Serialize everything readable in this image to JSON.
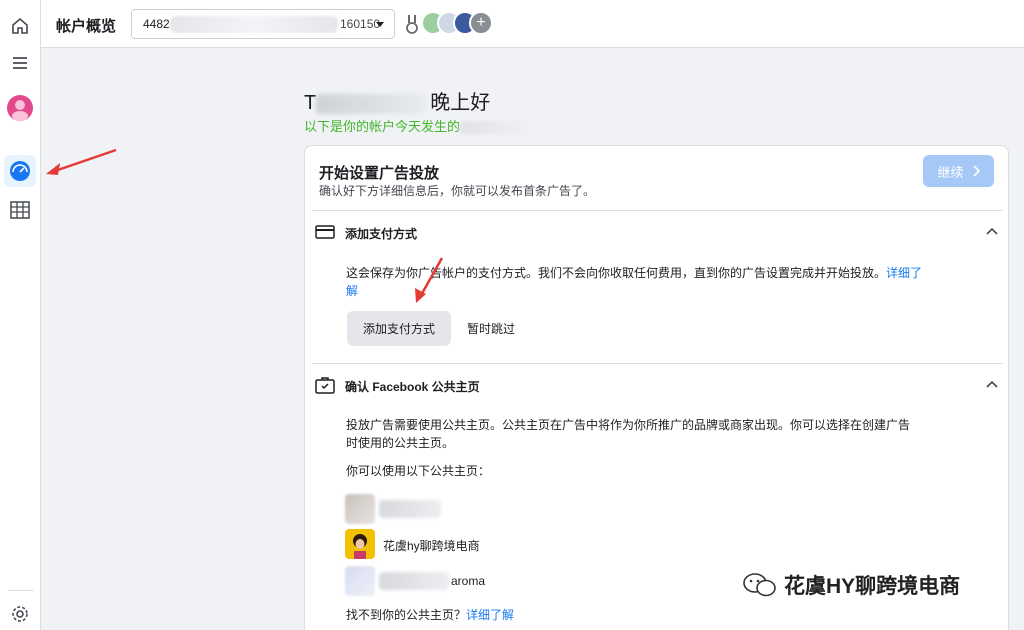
{
  "header": {
    "title": "帐户概览",
    "account_prefix": "4482",
    "account_suffix": "160150"
  },
  "greeting": {
    "name_start": "T",
    "text": "晚上好",
    "subtitle": "以下是你的帐户今天发生的"
  },
  "setup_card": {
    "title": "开始设置广告投放",
    "description": "确认好下方详细信息后，你就可以发布首条广告了。",
    "continue_label": "继续",
    "payment": {
      "heading": "添加支付方式",
      "text": "这会保存为你广告帐户的支付方式。我们不会向你收取任何费用，直到你的广告设置完成并开始投放。",
      "link": "详细了解",
      "add_button": "添加支付方式",
      "skip_button": "暂时跳过"
    },
    "page": {
      "heading": "确认 Facebook 公共主页",
      "text": "投放广告需要使用公共主页。公共主页在广告中将作为你所推广的品牌或商家出现。你可以选择在创建广告时使用的公共主页。",
      "available_label": "你可以使用以下公共主页：",
      "pages": [
        "",
        "花虞hy聊跨境电商",
        "aroma"
      ],
      "not_found": "找不到你的公共主页？",
      "not_found_link": "详细了解"
    }
  },
  "watermark": "花虞HY聊跨境电商",
  "colors": {
    "accent": "#1877f2",
    "green": "#42b72a",
    "annotation": "#e53935"
  }
}
